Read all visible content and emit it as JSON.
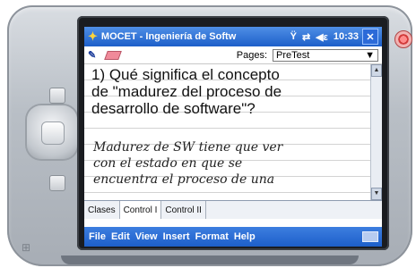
{
  "app": {
    "title": "MOCET - Ingeniería de Softw",
    "time": "10:33"
  },
  "toolbar": {
    "pages_label": "Pages:",
    "pages_selected": "PreTest"
  },
  "content": {
    "question_lines": [
      "1)  Qué significa el concepto",
      "de \"madurez del proceso de",
      "desarrollo de software\"?"
    ],
    "answer_lines": [
      "Madurez de SW tiene que ver",
      "con el estado en que se",
      "encuentra el proceso de una"
    ]
  },
  "tabs": [
    "Clases",
    "Control I",
    "Control II"
  ],
  "menu": [
    "File",
    "Edit",
    "View",
    "Insert",
    "Format",
    "Help"
  ],
  "icons": {
    "start": "windows-flag-icon",
    "signal": "antenna-icon",
    "sync": "sync-arrows-icon",
    "volume": "speaker-icon",
    "close": "close-icon",
    "pen": "pen-icon",
    "eraser": "eraser-icon",
    "keyboard": "keyboard-icon"
  },
  "colors": {
    "titlebar": "#1d5fc9",
    "menubar": "#1d5fc9"
  }
}
